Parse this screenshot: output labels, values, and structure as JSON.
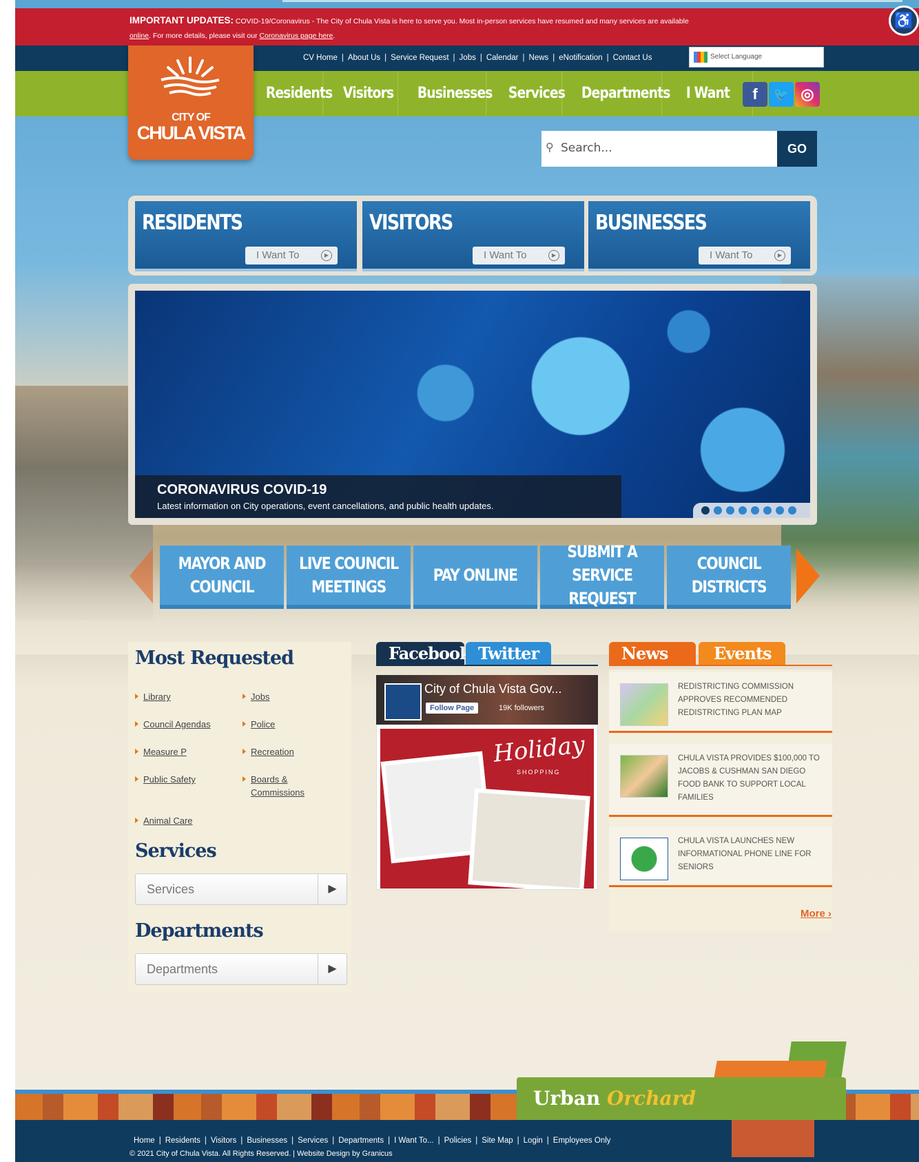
{
  "alert": {
    "title": "IMPORTANT UPDATES:",
    "line1": "COVID-19/Coronavirus - The City of Chula Vista is here to serve you. Most in-person services have resumed and many services are available",
    "online_link": "online",
    "line2": ". For more details, please visit our ",
    "corona_link": "Coronavirus page here",
    "line2_end": "."
  },
  "utility_nav": [
    "CV Home",
    "About Us",
    "Service Request",
    "Jobs",
    "Calendar",
    "News",
    "eNotification",
    "Contact Us"
  ],
  "language": {
    "placeholder": "Select Language"
  },
  "logo": {
    "line1": "CITY OF",
    "line2": "CHULA VISTA"
  },
  "main_nav": [
    "Residents",
    "Visitors",
    "Businesses",
    "Services",
    "Departments",
    "I Want to..."
  ],
  "social_icons": [
    "facebook-icon",
    "twitter-icon",
    "instagram-icon"
  ],
  "search": {
    "placeholder": "Search...",
    "button": "GO"
  },
  "audience_cards": [
    {
      "title": "RESIDENTS",
      "button": "I Want To"
    },
    {
      "title": "VISITORS",
      "button": "I Want To"
    },
    {
      "title": "BUSINESSES",
      "button": "I Want To"
    }
  ],
  "hero": {
    "title": "CORONAVIRUS COVID-19",
    "subtitle": "Latest information on City operations, event cancellations, and public health updates.",
    "slide_count": 8,
    "active_slide": 1
  },
  "quick_links": [
    "MAYOR AND COUNCIL",
    "LIVE COUNCIL MEETINGS",
    "PAY ONLINE",
    "SUBMIT A SERVICE REQUEST",
    "COUNCIL DISTRICTS"
  ],
  "most_requested": {
    "title": "Most Requested",
    "links": [
      "Library",
      "Jobs",
      "Council Agendas",
      "Police",
      "Measure P",
      "Recreation",
      "Public Safety",
      "Boards & Commissions",
      "Animal Care"
    ]
  },
  "services": {
    "title": "Services",
    "select": "Services"
  },
  "departments": {
    "title": "Departments",
    "select": "Departments"
  },
  "social_feed": {
    "tabs": [
      "Facebook",
      "Twitter"
    ],
    "page_name": "City of Chula Vista Gov...",
    "follow": "Follow Page",
    "followers": "19K followers",
    "promo_title": "Holiday",
    "promo_sub": "SHOPPING"
  },
  "news": {
    "tabs": [
      "News",
      "Events"
    ],
    "items": [
      "REDISTRICTING COMMISSION APPROVES RECOMMENDED REDISTRICTING PLAN MAP",
      "CHULA VISTA PROVIDES $100,000 TO JACOBS & CUSHMAN SAN DIEGO FOOD BANK TO SUPPORT LOCAL FAMILIES",
      "CHULA VISTA LAUNCHES NEW INFORMATIONAL PHONE LINE FOR SENIORS"
    ],
    "more": "More ›"
  },
  "footer": {
    "banner_a": "Urban ",
    "banner_b": "Orchard",
    "links": [
      "Home",
      "Residents",
      "Visitors",
      "Businesses",
      "Services",
      "Departments",
      "I Want To...",
      "Policies",
      "Site Map",
      "Login",
      "Employees Only"
    ],
    "copyright": "© 2021 City of Chula Vista. All Rights Reserved. | Website Design by Granicus"
  },
  "colors": {
    "alert": "#c41f2f",
    "navy": "#0f3b5e",
    "green": "#8fb42b",
    "orange": "#e0662a",
    "blue": "#4f9fd6"
  }
}
